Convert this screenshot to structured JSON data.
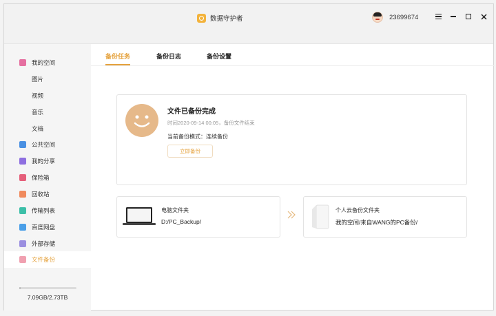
{
  "app": {
    "title": "数据守护者"
  },
  "user": {
    "id": "23699674"
  },
  "window_controls": {
    "menu": "menu-icon",
    "minimize": "minimize-icon",
    "maximize": "maximize-icon",
    "close": "close-icon"
  },
  "sidebar": {
    "items": [
      {
        "label": "我的空间",
        "icon": "space-icon",
        "color": "#e56fa0",
        "sub": false
      },
      {
        "label": "图片",
        "sub": true
      },
      {
        "label": "视频",
        "sub": true
      },
      {
        "label": "音乐",
        "sub": true
      },
      {
        "label": "文档",
        "sub": true
      },
      {
        "label": "公共空间",
        "icon": "public-space-icon",
        "color": "#4a90e2",
        "sub": false
      },
      {
        "label": "我的分享",
        "icon": "share-icon",
        "color": "#8e6fe0",
        "sub": false
      },
      {
        "label": "保险箱",
        "icon": "safe-icon",
        "color": "#e55f7a",
        "sub": false
      },
      {
        "label": "回收站",
        "icon": "recycle-bin-icon",
        "color": "#f08a5d",
        "sub": false
      },
      {
        "label": "传输列表",
        "icon": "transfer-icon",
        "color": "#3cbfa8",
        "sub": false
      },
      {
        "label": "百度网盘",
        "icon": "baidu-netdisk-icon",
        "color": "#4a9fe8",
        "sub": false
      },
      {
        "label": "外部存储",
        "icon": "external-storage-icon",
        "color": "#9b8fe0",
        "sub": false
      },
      {
        "label": "文件备份",
        "icon": "file-backup-icon",
        "color": "#f0a0b0",
        "sub": false,
        "active": true
      }
    ],
    "storage": {
      "text": "7.09GB/2.73TB",
      "fraction": 0.0025
    }
  },
  "tabs": [
    {
      "label": "备份任务",
      "active": true
    },
    {
      "label": "备份日志",
      "active": false
    },
    {
      "label": "备份设置",
      "active": false
    }
  ],
  "status": {
    "title": "文件已备份完成",
    "time": "时间2020-09-14 00:05，备份文件结束",
    "mode": "当前备份模式：连续备份",
    "button": "立即备份"
  },
  "source": {
    "label": "电脑文件夹",
    "path": "D:/PC_Backup/"
  },
  "target": {
    "label": "个人云备份文件夹",
    "path": "我的空间/来自WANG的PC备份/"
  },
  "colors": {
    "accent": "#e5a23d",
    "smiley": "#e6b98a"
  }
}
